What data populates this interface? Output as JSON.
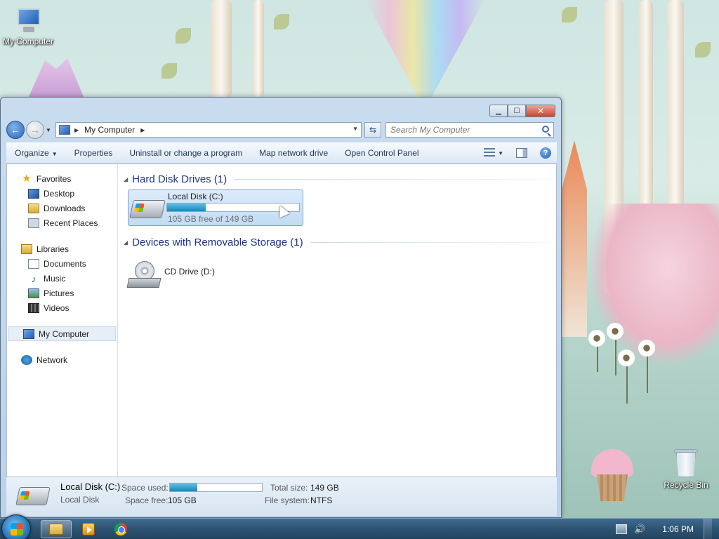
{
  "desktop": {
    "icons": [
      {
        "label": "My Computer",
        "icon": "my-computer-icon"
      },
      {
        "label": "Recycle Bin",
        "icon": "recycle-bin-icon"
      }
    ]
  },
  "window": {
    "caption_buttons": {
      "minimize": "▁",
      "maximize": "☐",
      "close": "✕"
    }
  },
  "navbar": {
    "address_path": [
      "My Computer"
    ],
    "search_placeholder": "Search My Computer"
  },
  "toolbar": {
    "organize": "Organize",
    "properties": "Properties",
    "uninstall": "Uninstall or change a program",
    "map_drive": "Map network drive",
    "control_panel": "Open Control Panel"
  },
  "navpane": {
    "favorites": {
      "label": "Favorites",
      "items": [
        "Desktop",
        "Downloads",
        "Recent Places"
      ]
    },
    "libraries": {
      "label": "Libraries",
      "items": [
        "Documents",
        "Music",
        "Pictures",
        "Videos"
      ]
    },
    "computer": {
      "label": "My Computer"
    },
    "network": {
      "label": "Network"
    }
  },
  "main": {
    "hdd_section": "Hard Disk Drives (1)",
    "removable_section": "Devices with Removable Storage (1)",
    "local_disk": {
      "name": "Local Disk (C:)",
      "free_text": "105 GB free of 149 GB",
      "used_fraction": 0.295
    },
    "cd_drive": {
      "name": "CD Drive (D:)"
    }
  },
  "details": {
    "title": "Local Disk (C:)",
    "subtitle": "Local Disk",
    "space_used_label": "Space used:",
    "space_free_label": "Space free:",
    "space_free_value": "105 GB",
    "total_size_label": "Total size:",
    "total_size_value": "149 GB",
    "file_system_label": "File system:",
    "file_system_value": "NTFS"
  },
  "taskbar": {
    "apps": [
      {
        "name": "Windows Explorer",
        "icon": "folder-icon",
        "active": true
      },
      {
        "name": "Windows Media Player",
        "icon": "media-player-icon",
        "active": false
      },
      {
        "name": "Google Chrome",
        "icon": "chrome-icon",
        "active": false
      }
    ],
    "clock": "1:06 PM"
  }
}
